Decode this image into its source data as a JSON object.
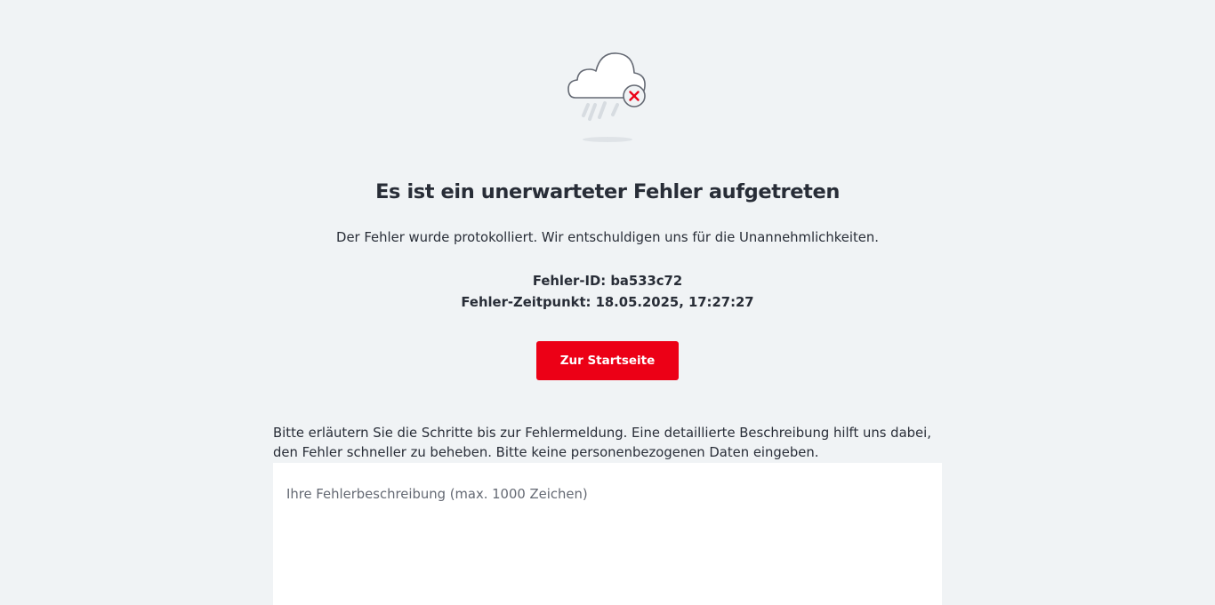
{
  "error_page": {
    "title": "Es ist ein unerwarteter Fehler aufgetreten",
    "subtitle": "Der Fehler wurde protokolliert. Wir entschuldigen uns für die Unannehmlichkeiten.",
    "error_id_label": "Fehler-ID: ba533c72",
    "error_time_label": "Fehler-Zeitpunkt: 18.05.2025, 17:27:27",
    "home_button_label": "Zur Startseite",
    "illustration_icon": "cloud-error-icon",
    "accent_color": "#ec0016"
  },
  "feedback": {
    "instructions": "Bitte erläutern Sie die Schritte bis zur Fehlermeldung. Eine detaillierte Beschreibung hilft uns dabei, den Fehler schneller zu beheben. Bitte keine personenbezogenen Daten eingeben.",
    "placeholder": "Ihre Fehlerbeschreibung (max. 1000 Zeichen)",
    "value": ""
  }
}
